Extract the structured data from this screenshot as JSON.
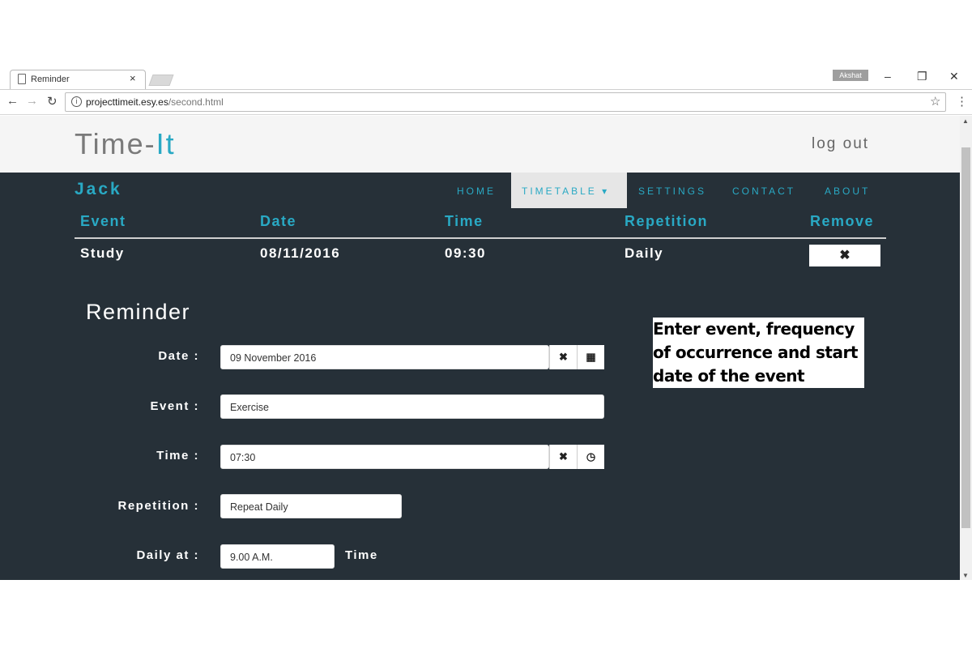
{
  "browser": {
    "tab_title": "Reminder",
    "user": "Akshat",
    "url_domain": "projecttimeit.esy.es",
    "url_path": "/second.html"
  },
  "header": {
    "brand_main": "Time-",
    "brand_accent": "It",
    "logout": "log out"
  },
  "nav": {
    "user": "Jack",
    "links": [
      "HOME",
      "TIMETABLE ▾",
      "SETTINGS",
      "CONTACT",
      "ABOUT"
    ],
    "active": "TIMETABLE"
  },
  "table": {
    "headers": [
      "Event",
      "Date",
      "Time",
      "Repetition",
      "Remove"
    ],
    "rows": [
      {
        "event": "Study",
        "date": "08/11/2016",
        "time": "09:30",
        "repetition": "Daily",
        "remove": "✖"
      }
    ]
  },
  "form": {
    "title": "Reminder",
    "date_label": "Date :",
    "date_value": "09 November 2016",
    "event_label": "Event :",
    "event_value": "Exercise",
    "time_label": "Time :",
    "time_value": "07:30",
    "repetition_label": "Repetition :",
    "repetition_value": "Repeat Daily",
    "daily_label": "Daily at :",
    "daily_value": "9.00 A.M.",
    "daily_suffix": "Time",
    "clear_icon": "✖",
    "calendar_icon": "▦",
    "clock_icon": "◷"
  },
  "note": {
    "text": "Enter event, frequency of occurrence and start date of the event"
  },
  "colors": {
    "accent": "#29a9c4",
    "dark_bg": "#263038"
  }
}
